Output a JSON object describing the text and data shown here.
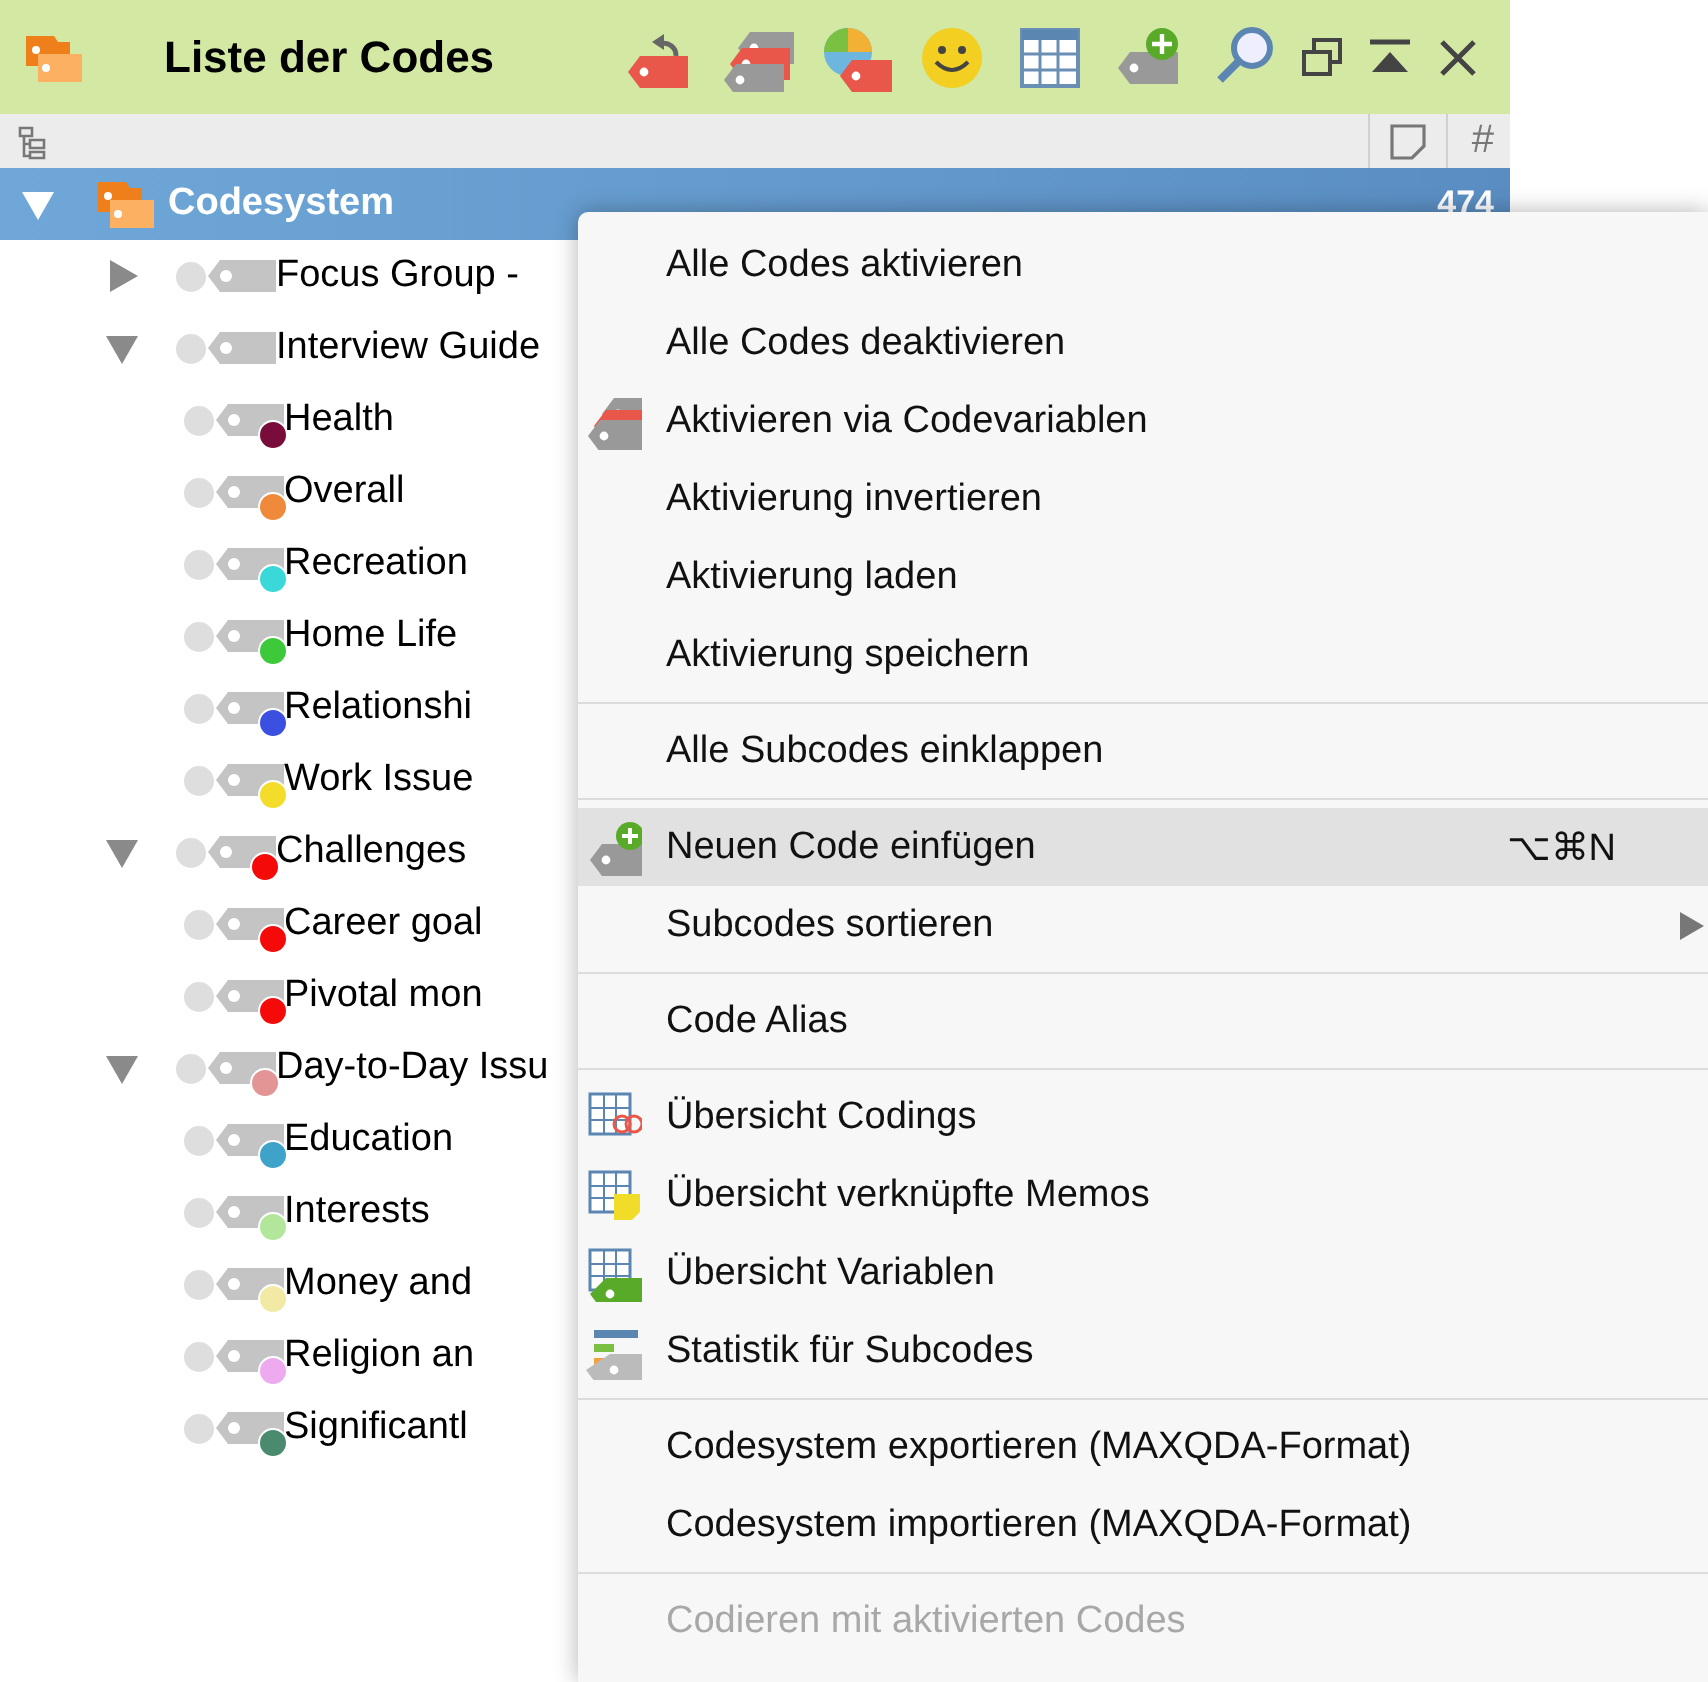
{
  "window": {
    "title": "Liste der Codes"
  },
  "column_header": "#",
  "root": {
    "label": "Codesystem",
    "count": "474",
    "expanded": true
  },
  "codes": [
    {
      "label": "Focus Group -",
      "expanded": false
    },
    {
      "label": "Interview Guide",
      "expanded": true,
      "children": [
        {
          "label": "Health",
          "color": "#7a0c3c"
        },
        {
          "label": "Overall",
          "color": "#ee8a3a"
        },
        {
          "label": "Recreation",
          "color": "#3ad8d8"
        },
        {
          "label": "Home Life",
          "color": "#3ec93a"
        },
        {
          "label": "Relationshi",
          "color": "#3b4fe0"
        },
        {
          "label": "Work Issue",
          "color": "#f4dd2a"
        }
      ]
    },
    {
      "label": "Challenges",
      "expanded": true,
      "color": "#f50a0a",
      "children": [
        {
          "label": "Career goal",
          "color": "#f50a0a"
        },
        {
          "label": "Pivotal mon",
          "color": "#f50a0a"
        }
      ]
    },
    {
      "label": "Day-to-Day Issu",
      "expanded": true,
      "color": "#e39494",
      "children": [
        {
          "label": "Education",
          "color": "#3fa3c9"
        },
        {
          "label": "Interests",
          "color": "#b2e69a"
        },
        {
          "label": "Money and",
          "color": "#f2eaa4"
        },
        {
          "label": "Religion an",
          "color": "#eeaaee"
        },
        {
          "label": "Significantl",
          "color": "#4a8a6e"
        }
      ]
    }
  ],
  "menu": {
    "groups": [
      [
        {
          "label": "Alle Codes aktivieren",
          "kind": "plain",
          "selected": false,
          "disabled": false,
          "submenu": false
        },
        {
          "label": "Alle Codes deaktivieren",
          "kind": "plain",
          "selected": false,
          "disabled": false,
          "submenu": false
        },
        {
          "label": "Aktivieren via Codevariablen",
          "kind": "tags",
          "selected": false,
          "disabled": false,
          "submenu": false
        },
        {
          "label": "Aktivierung invertieren",
          "kind": "plain",
          "selected": false,
          "disabled": false,
          "submenu": false
        },
        {
          "label": "Aktivierung laden",
          "kind": "plain",
          "selected": false,
          "disabled": false,
          "submenu": false
        },
        {
          "label": "Aktivierung speichern",
          "kind": "plain",
          "selected": false,
          "disabled": false,
          "submenu": false
        }
      ],
      [
        {
          "label": "Alle Subcodes einklappen",
          "kind": "plain",
          "selected": false,
          "disabled": false,
          "submenu": false
        }
      ],
      [
        {
          "label": "Neuen Code einfügen",
          "kind": "add",
          "shortcut": "⌥⌘N",
          "selected": true,
          "disabled": false,
          "submenu": false
        },
        {
          "label": "Subcodes sortieren",
          "kind": "plain",
          "selected": false,
          "disabled": false,
          "submenu": true
        }
      ],
      [
        {
          "label": "Code Alias",
          "kind": "plain",
          "selected": false,
          "disabled": false,
          "submenu": false
        }
      ],
      [
        {
          "label": "Übersicht Codings",
          "kind": "table-codings",
          "selected": false,
          "disabled": false,
          "submenu": false
        },
        {
          "label": "Übersicht verknüpfte Memos",
          "kind": "table-memos",
          "selected": false,
          "disabled": false,
          "submenu": false
        },
        {
          "label": "Übersicht Variablen",
          "kind": "table-variables",
          "selected": false,
          "disabled": false,
          "submenu": false
        },
        {
          "label": "Statistik für Subcodes",
          "kind": "stats",
          "selected": false,
          "disabled": false,
          "submenu": false
        }
      ],
      [
        {
          "label": "Codesystem exportieren (MAXQDA-Format)",
          "kind": "plain",
          "selected": false,
          "disabled": false,
          "submenu": false
        },
        {
          "label": "Codesystem importieren (MAXQDA-Format)",
          "kind": "plain",
          "selected": false,
          "disabled": false,
          "submenu": false
        }
      ],
      [
        {
          "label": "Codieren mit aktivierten Codes",
          "kind": "plain",
          "selected": false,
          "disabled": true,
          "submenu": false
        }
      ]
    ]
  }
}
